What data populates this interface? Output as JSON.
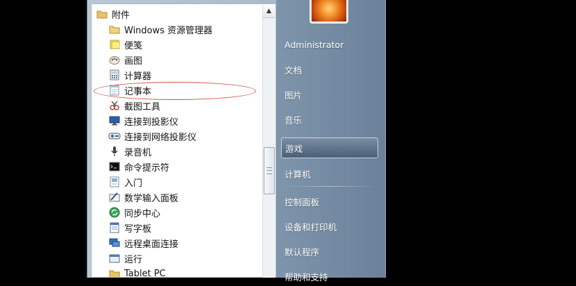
{
  "programs_panel": {
    "folder_label": "附件",
    "items": [
      {
        "label": "Windows 资源管理器",
        "icon": "explorer-icon"
      },
      {
        "label": "便笺",
        "icon": "sticky-notes-icon"
      },
      {
        "label": "画图",
        "icon": "paint-icon"
      },
      {
        "label": "计算器",
        "icon": "calculator-icon"
      },
      {
        "label": "记事本",
        "icon": "notepad-icon"
      },
      {
        "label": "截图工具",
        "icon": "snipping-tool-icon"
      },
      {
        "label": "连接到投影仪",
        "icon": "projector-icon"
      },
      {
        "label": "连接到网络投影仪",
        "icon": "network-projector-icon"
      },
      {
        "label": "录音机",
        "icon": "microphone-icon"
      },
      {
        "label": "命令提示符",
        "icon": "command-prompt-icon"
      },
      {
        "label": "入门",
        "icon": "getting-started-icon"
      },
      {
        "label": "数学输入面板",
        "icon": "math-input-icon"
      },
      {
        "label": "同步中心",
        "icon": "sync-center-icon"
      },
      {
        "label": "写字板",
        "icon": "wordpad-icon"
      },
      {
        "label": "远程桌面连接",
        "icon": "remote-desktop-icon"
      },
      {
        "label": "运行",
        "icon": "run-icon"
      },
      {
        "label": "Tablet PC",
        "icon": "folder-icon"
      }
    ]
  },
  "right_panel": {
    "user_name": "Administrator",
    "items": [
      {
        "label": "文档"
      },
      {
        "label": "图片"
      },
      {
        "label": "音乐"
      },
      {
        "label": "游戏"
      },
      {
        "label": "计算机"
      },
      {
        "label": "控制面板"
      },
      {
        "label": "设备和打印机"
      },
      {
        "label": "默认程序"
      },
      {
        "label": "帮助和支持"
      }
    ]
  },
  "colors": {
    "highlight_ellipse": "#d0504a",
    "right_panel": "#6a8199",
    "selected_item": "#4a6077"
  }
}
